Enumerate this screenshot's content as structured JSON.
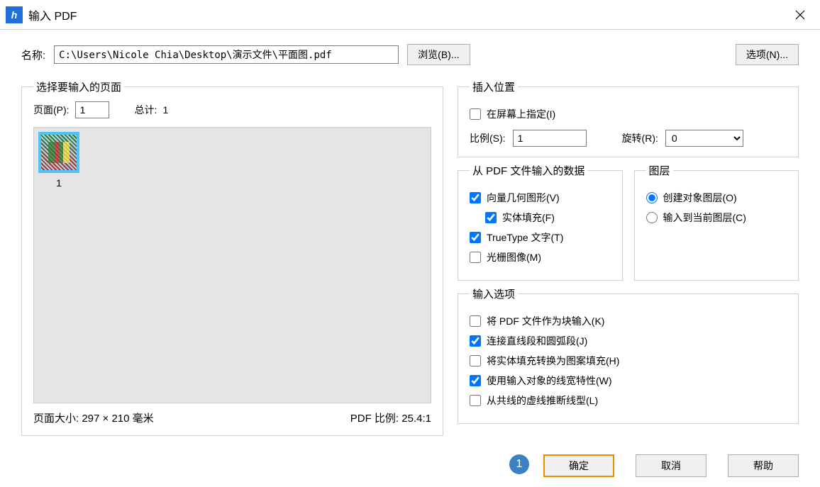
{
  "titlebar": {
    "title": "输入 PDF",
    "icon_letter": "h"
  },
  "top": {
    "name_label": "名称:",
    "path": "C:\\Users\\Nicole Chia\\Desktop\\演示文件\\平面图.pdf",
    "browse_btn": "浏览(B)...",
    "options_btn": "选项(N)..."
  },
  "left": {
    "legend": "选择要输入的页面",
    "page_label": "页面(P):",
    "page_value": "1",
    "total_label": "总计:",
    "total_value": "1",
    "thumb_label": "1",
    "page_size_label": "页面大小:",
    "page_size_value": "297 × 210 毫米",
    "pdf_scale_label": "PDF 比例:",
    "pdf_scale_value": "25.4:1"
  },
  "insert_pos": {
    "legend": "插入位置",
    "specify_on_screen": "在屏幕上指定(I)",
    "scale_label": "比例(S):",
    "scale_value": "1",
    "rotation_label": "旋转(R):",
    "rotation_value": "0"
  },
  "pdf_data": {
    "legend": "从 PDF 文件输入的数据",
    "vector": "向量几何图形(V)",
    "solid_fill": "实体填充(F)",
    "truetype": "TrueType 文字(T)",
    "raster": "光栅图像(M)"
  },
  "layers": {
    "legend": "图层",
    "create_obj": "创建对象图层(O)",
    "import_cur": "输入到当前图层(C)"
  },
  "import_opts": {
    "legend": "输入选项",
    "as_block": "将 PDF 文件作为块输入(K)",
    "join_lines": "连接直线段和圆弧段(J)",
    "solid_to_hatch": "将实体填充转换为图案填充(H)",
    "use_lineweight": "使用输入对象的线宽特性(W)",
    "infer_linetype": "从共线的虚线推断线型(L)"
  },
  "buttons": {
    "ok": "确定",
    "cancel": "取消",
    "help": "帮助"
  },
  "badge": {
    "number": "1"
  }
}
